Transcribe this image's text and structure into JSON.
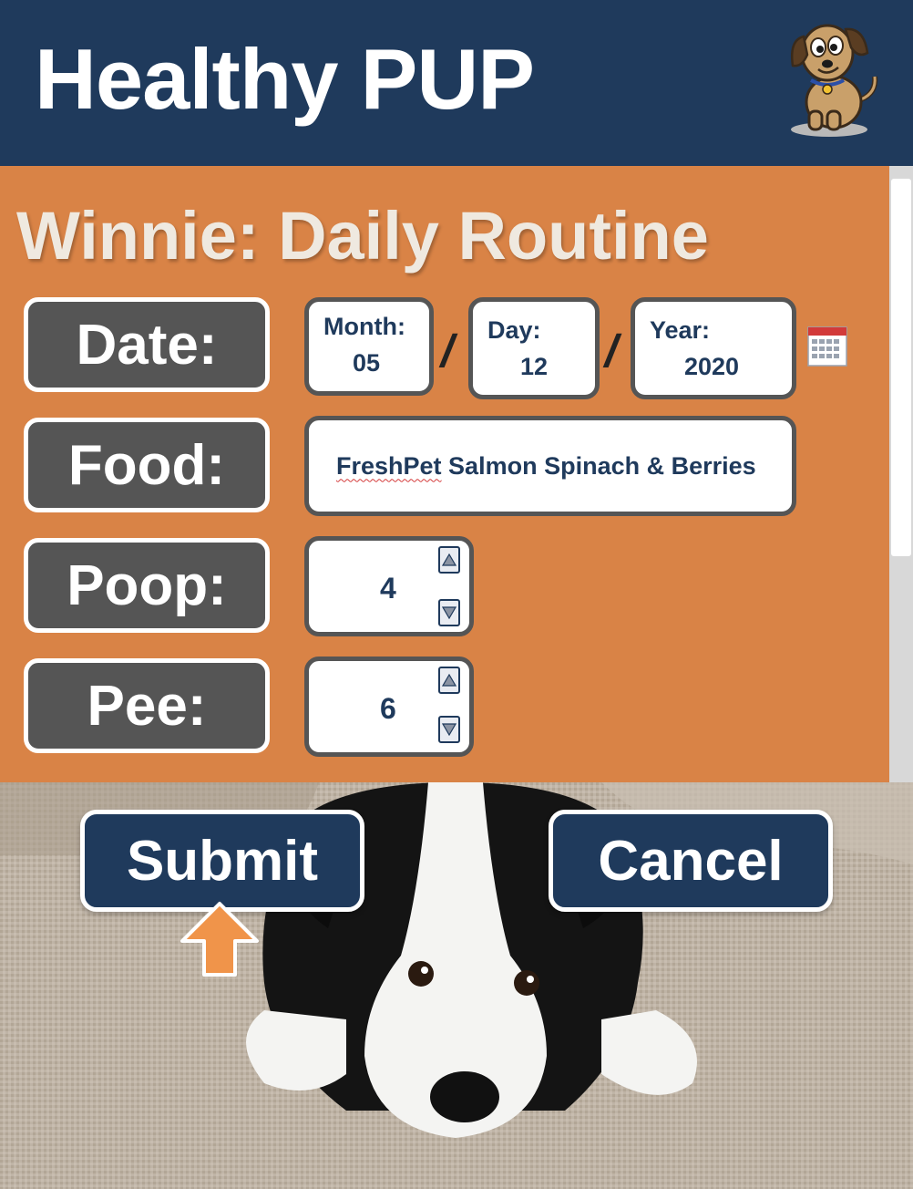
{
  "app": {
    "title": "Healthy PUP",
    "logo_icon": "cartoon-dog-logo"
  },
  "form": {
    "title": "Winnie: Daily Routine",
    "date": {
      "label": "Date:",
      "month_label": "Month:",
      "month_value": "05",
      "day_label": "Day:",
      "day_value": "12",
      "year_label": "Year:",
      "year_value": "2020",
      "separator": "/",
      "calendar_icon": "calendar-icon"
    },
    "food": {
      "label": "Food:",
      "brand": "FreshPet",
      "rest": " Salmon Spinach & Berries"
    },
    "poop": {
      "label": "Poop:",
      "value": "4"
    },
    "pee": {
      "label": "Pee:",
      "value": "6"
    }
  },
  "actions": {
    "submit_label": "Submit",
    "cancel_label": "Cancel",
    "pointer_icon": "up-arrow-icon"
  },
  "colors": {
    "header": "#1f3a5c",
    "panel": "#d98346",
    "label_bg": "#555555",
    "arrow": "#f0944a"
  }
}
